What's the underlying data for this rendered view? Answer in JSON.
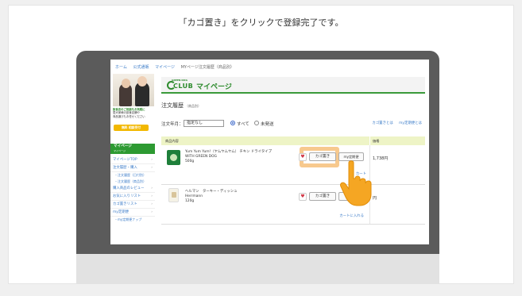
{
  "caption": "「カゴ置き」をクリックで登録完了です。",
  "breadcrumb": [
    "ホーム",
    "公式通販",
    "マイページ",
    "MYページ注文履歴（商品別）"
  ],
  "sidebar": {
    "promo_line1": "飲食店のご相談もお気軽に",
    "promo_line2": "愛犬家様の飲食店舗や",
    "promo_line3": "商品選びもお任せください",
    "call_button": "無料 相談受付",
    "mypage_label": "マイページ",
    "mypage_sub": "マイページ",
    "items": [
      {
        "label": "マイページTOP",
        "type": "item"
      },
      {
        "label": "注文履歴・購入",
        "type": "item"
      },
      {
        "label": "・注文履歴（日付別）",
        "type": "sub"
      },
      {
        "label": "・注文履歴（商品別）",
        "type": "sub"
      },
      {
        "label": "購入商品のレビュー",
        "type": "item"
      },
      {
        "label": "お気に入りリスト",
        "type": "item"
      },
      {
        "label": "カゴ置きリスト",
        "type": "item"
      },
      {
        "label": "my定期便",
        "type": "item"
      },
      {
        "label": "・my定期便ナップ",
        "type": "sub"
      }
    ]
  },
  "header": {
    "logo_top": "GREEN DOG",
    "logo_main": "CLUB",
    "title": "マイページ"
  },
  "order": {
    "title": "注文履歴",
    "title_small": "（商品別）",
    "filter_label": "注文年月：",
    "select_value": "指定なし",
    "radio_all": "すべて",
    "radio_unsent": "未発送",
    "link_cart": "カゴ置きとは",
    "link_regular": "my定期便とは"
  },
  "table": {
    "col_product": "商品内容",
    "col_price": "価格",
    "rows": [
      {
        "name_line1": "Yum Yum Yum!（ヤムヤムヤム） チキン ドライタイプ",
        "name_line2": "WITH GREEN DOG",
        "name_line3": "500g",
        "heart": "♥",
        "cart_button": "カゴ置き",
        "regular_button": "my定期便",
        "cart_link": "カート",
        "price": "1,738円"
      },
      {
        "name_line1": "ヘルマン　ターキー・ディッシュ",
        "name_line2": "Herrmann",
        "name_line3": "120g",
        "heart": "♥",
        "cart_button": "カゴ置き",
        "regular_button": "my",
        "cart_link": "カートに入れる",
        "price": "円"
      }
    ]
  }
}
